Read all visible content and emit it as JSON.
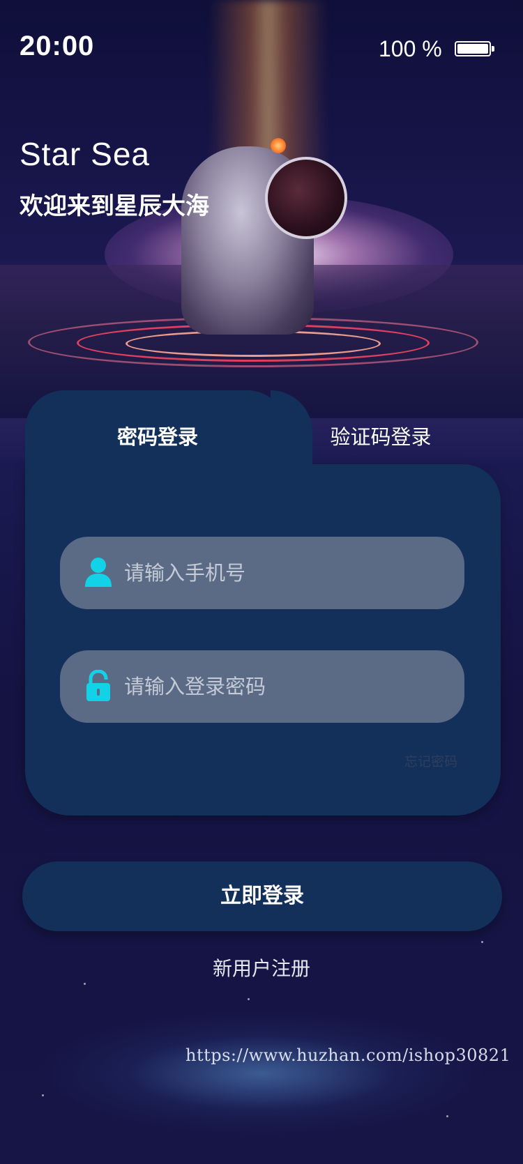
{
  "status_bar": {
    "time": "20:00",
    "battery_text": "100 %"
  },
  "header": {
    "title": "Star Sea",
    "welcome": "欢迎来到星辰大海"
  },
  "login": {
    "tabs": [
      {
        "label": "密码登录",
        "active": true
      },
      {
        "label": "验证码登录",
        "active": false
      }
    ],
    "phone_field": {
      "placeholder": "请输入手机号",
      "value": "",
      "icon": "user-icon"
    },
    "password_field": {
      "placeholder": "请输入登录密码",
      "value": "",
      "icon": "lock-icon"
    },
    "forgot_label": "忘记密码",
    "submit_label": "立即登录",
    "register_label": "新用户注册"
  },
  "watermark": "https://www.huzhan.com/ishop30821",
  "colors": {
    "accent_icon": "#11d2e6",
    "card_bg": "#12305a",
    "input_bg": "#5b6b86",
    "page_bg": "#14133f"
  }
}
